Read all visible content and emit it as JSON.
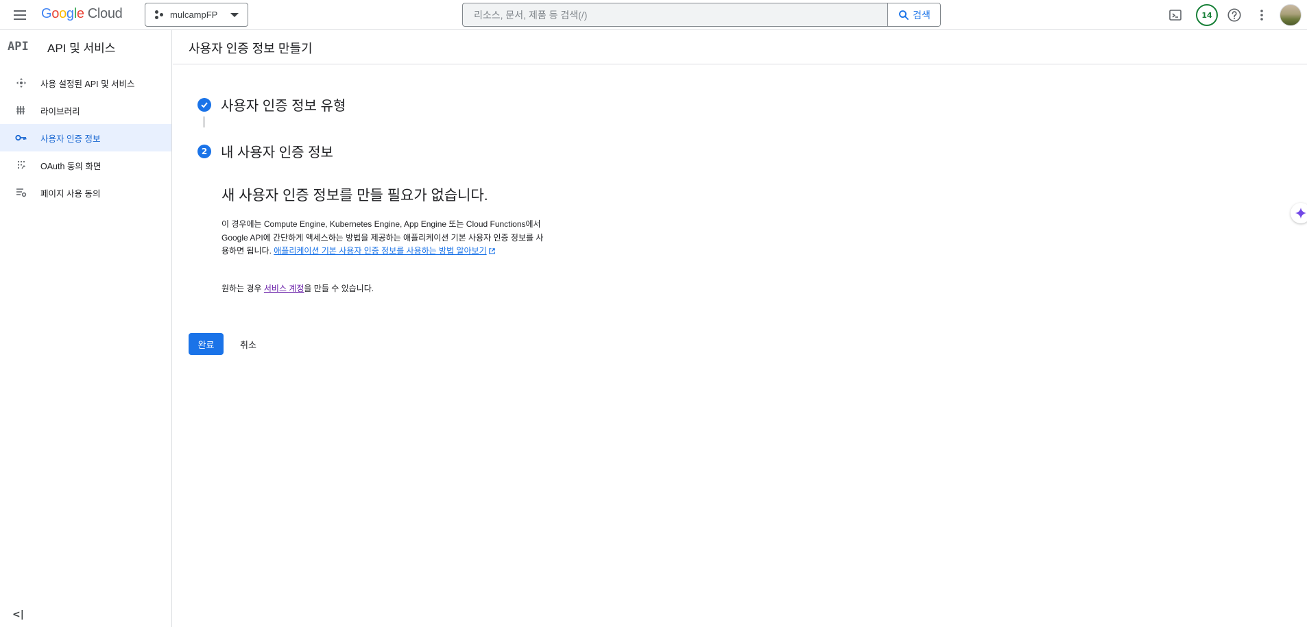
{
  "header": {
    "logo_google": "Google",
    "logo_cloud": "Cloud",
    "project_name": "mulcampFP",
    "search_placeholder": "리소스, 문서, 제품 등 검색(/)",
    "search_button": "검색",
    "notifications_count": "14"
  },
  "sidebar": {
    "logo_text": "API",
    "title": "API 및 서비스",
    "items": [
      {
        "label": "사용 설정된 API 및 서비스",
        "icon": "apis-icon",
        "active": false
      },
      {
        "label": "라이브러리",
        "icon": "library-icon",
        "active": false
      },
      {
        "label": "사용자 인증 정보",
        "icon": "key-icon",
        "active": true
      },
      {
        "label": "OAuth 동의 화면",
        "icon": "oauth-icon",
        "active": false
      },
      {
        "label": "페이지 사용 동의",
        "icon": "page-usage-icon",
        "active": false
      }
    ],
    "collapse_label": "<|"
  },
  "page": {
    "title": "사용자 인증 정보 만들기"
  },
  "steps": [
    {
      "label": "사용자 인증 정보 유형",
      "state": "done"
    },
    {
      "number": "2",
      "label": "내 사용자 인증 정보",
      "state": "active"
    }
  ],
  "content": {
    "headline": "새 사용자 인증 정보를 만들 필요가 없습니다.",
    "paragraph_text": "이 경우에는 Compute Engine, Kubernetes Engine, App Engine 또는 Cloud Functions에서 Google API에 간단하게 액세스하는 방법을 제공하는 애플리케이션 기본 사용자 인증 정보를 사용하면 됩니다. ",
    "paragraph_link": "애플리케이션 기본 사용자 인증 정보를 사용하는 방법 알아보기",
    "service_prefix": "원하는 경우 ",
    "service_link": "서비스 계정",
    "service_suffix": "을 만들 수 있습니다."
  },
  "actions": {
    "done_label": "완료",
    "cancel_label": "취소"
  },
  "colors": {
    "accent": "#1a73e8",
    "active_nav_bg": "#e8f0fe",
    "visited_link": "#681da8",
    "badge_green": "#188038"
  }
}
